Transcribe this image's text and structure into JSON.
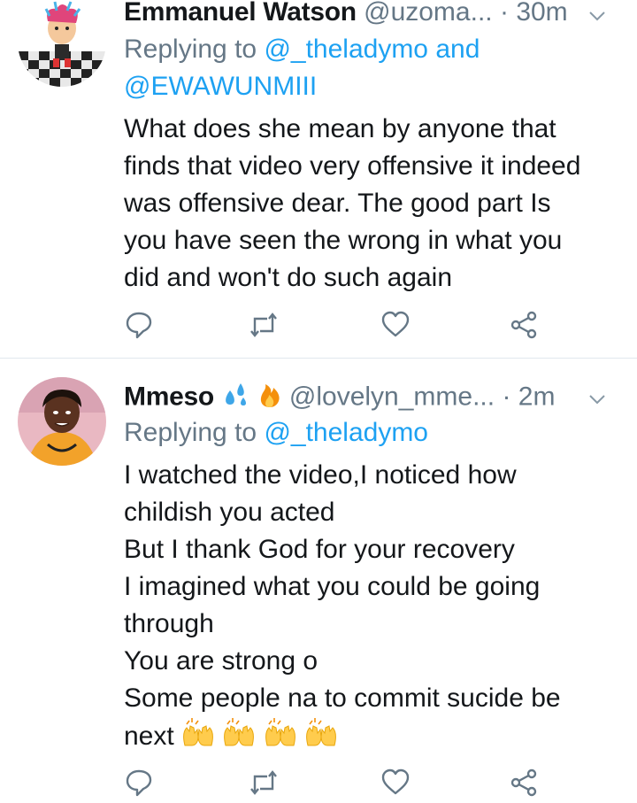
{
  "tweets": [
    {
      "name": "Emmanuel Watson",
      "handle": "@uzoma...",
      "dot": "·",
      "time": "30m",
      "reply_prefix": "Replying to",
      "reply_mention_1": "@_theladymo",
      "reply_and": "and",
      "reply_mention_2": "@EWAWUNMIII",
      "lines": [
        "What does she mean by anyone that",
        "finds that video very offensive it indeed",
        "was offensive dear. The good part Is",
        "you have seen the wrong in what you",
        "did and won't do such again"
      ],
      "icons": [
        "reply-icon",
        "retweet-icon",
        "like-icon",
        "share-icon"
      ]
    },
    {
      "name": "Mmeso",
      "name_emojis": [
        "sweat-droplets-emoji",
        "fire-emoji"
      ],
      "handle": "@lovelyn_mme...",
      "dot": "·",
      "time": "2m",
      "reply_prefix": "Replying to",
      "reply_mention_1": "@_theladymo",
      "lines": [
        "I watched the video,I noticed how",
        "childish you acted",
        "But I thank God for your recovery",
        "I imagined what you could be going",
        "through",
        "You are strong o",
        "Some people na to commit sucide be",
        "next"
      ],
      "trailing_emojis": [
        "raising-hands-emoji",
        "raising-hands-emoji",
        "raising-hands-emoji",
        "raising-hands-emoji"
      ],
      "icons": [
        "reply-icon",
        "retweet-icon",
        "like-icon",
        "share-icon"
      ]
    }
  ],
  "colors": {
    "link": "#1da1f2",
    "muted": "#657786",
    "text": "#14171a",
    "divider": "#e1e8ed"
  }
}
